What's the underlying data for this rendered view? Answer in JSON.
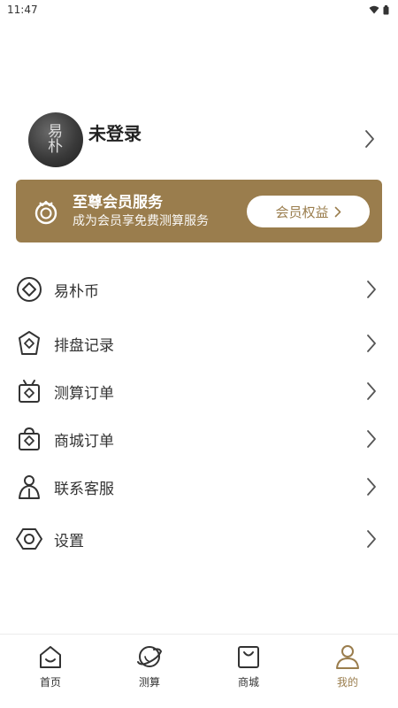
{
  "status_bar": {
    "time": "11:47"
  },
  "profile": {
    "avatar_text_top": "易",
    "avatar_text_bottom": "朴",
    "username": "未登录"
  },
  "vip": {
    "title": "至尊会员服务",
    "subtitle": "成为会员享免费测算服务",
    "button_label": "会员权益"
  },
  "menu": [
    {
      "label": "易朴币",
      "icon": "diamond-coin-icon"
    },
    {
      "label": "排盘记录",
      "icon": "record-tag-icon"
    },
    {
      "label": "测算订单",
      "icon": "calc-order-icon"
    },
    {
      "label": "商城订单",
      "icon": "shop-bag-icon"
    },
    {
      "label": "联系客服",
      "icon": "customer-service-icon"
    },
    {
      "label": "设置",
      "icon": "settings-hex-icon"
    }
  ],
  "tabs": [
    {
      "label": "首页",
      "icon": "home-icon",
      "active": false
    },
    {
      "label": "测算",
      "icon": "planet-icon",
      "active": false
    },
    {
      "label": "商城",
      "icon": "bag-icon",
      "active": false
    },
    {
      "label": "我的",
      "icon": "user-icon",
      "active": true
    }
  ],
  "colors": {
    "accent": "#9a7d4d",
    "text": "#333333",
    "background": "#ffffff"
  }
}
